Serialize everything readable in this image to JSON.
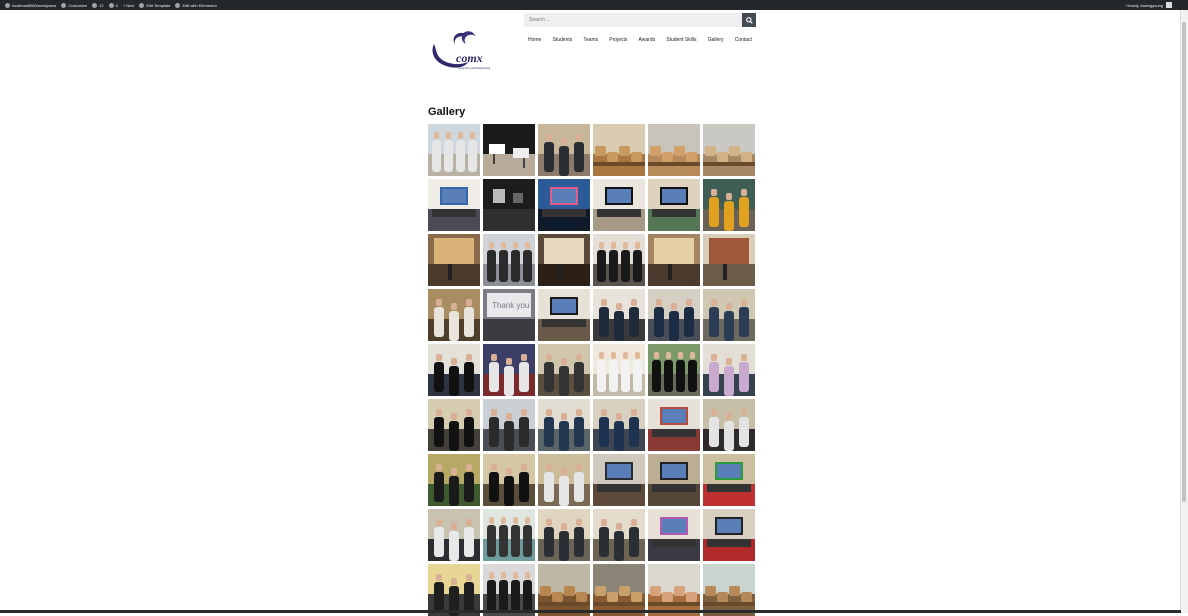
{
  "admin_bar": {
    "site": "localhost8080/wordpress",
    "customize": "Customize",
    "comments": "12",
    "updates": "0",
    "new": "New",
    "edit_template": "Edit Template",
    "elementor": "Edit with Elementor",
    "howdy": "Howdy, kwangyoung"
  },
  "header": {
    "search_placeholder": "Search ...",
    "logo_text": "comx",
    "logo_tagline": "Computing and Engineering"
  },
  "nav": [
    "Home",
    "Students",
    "Teams",
    "Projects",
    "Awards",
    "Student Skills",
    "Gallery",
    "Contact"
  ],
  "page": {
    "title": "Gallery"
  },
  "gallery": {
    "photos": [
      {
        "scene": "people-group",
        "sky": "#cfd6dc",
        "floor": "#b9b0a6",
        "fig": "#e6e6e6"
      },
      {
        "scene": "tables",
        "sky": "#1b1b1b",
        "floor": "#b7aa98",
        "fig": "#ddd"
      },
      {
        "scene": "people",
        "sky": "#c9b79b",
        "floor": "#8c7b6a",
        "fig": "#2a2e35"
      },
      {
        "scene": "food",
        "sky": "#d9cbb1",
        "floor": "#a9773f",
        "fig": "#c69a5e"
      },
      {
        "scene": "food",
        "sky": "#c8c3bb",
        "floor": "#b78a5a",
        "fig": "#d4a06a"
      },
      {
        "scene": "food",
        "sky": "#c9c8c2",
        "floor": "#a78865",
        "fig": "#d2b287"
      },
      {
        "scene": "screen",
        "sky": "#f0ede6",
        "floor": "#4b4b55",
        "fig": "#3366aa"
      },
      {
        "scene": "dark",
        "sky": "#1c1c1c",
        "floor": "#2f2f2f",
        "fig": "#bbb"
      },
      {
        "scene": "screen",
        "sky": "#2a5a98",
        "floor": "#0f1a2b",
        "fig": "#e05a8a"
      },
      {
        "scene": "screen",
        "sky": "#ece7de",
        "floor": "#a69a86",
        "fig": "#111"
      },
      {
        "scene": "screen",
        "sky": "#ddd3bf",
        "floor": "#557755",
        "fig": "#111"
      },
      {
        "scene": "people",
        "sky": "#3e5d55",
        "floor": "#6a6254",
        "fig": "#e0a020"
      },
      {
        "scene": "projector",
        "sky": "#8a6a4a",
        "floor": "#4a3a2a",
        "fig": "#d9b27a"
      },
      {
        "scene": "people-group",
        "sky": "#cfd3d8",
        "floor": "#8a8f96",
        "fig": "#2b2b2b"
      },
      {
        "scene": "projector",
        "sky": "#5a4a3a",
        "floor": "#2a2018",
        "fig": "#e8d9c0"
      },
      {
        "scene": "people-group",
        "sky": "#e3ded6",
        "floor": "#5a544c",
        "fig": "#1a1a1a"
      },
      {
        "scene": "projector",
        "sky": "#a58461",
        "floor": "#4a3b2e",
        "fig": "#e6cfa5"
      },
      {
        "scene": "projector",
        "sky": "#d8cdb9",
        "floor": "#6b5b49",
        "fig": "#a05a3a"
      },
      {
        "scene": "people",
        "sky": "#a98d62",
        "floor": "#4e3f2c",
        "fig": "#e8e4dc"
      },
      {
        "scene": "thankyou",
        "sky": "#7a7d86",
        "floor": "#3a3c42",
        "fig": "#e8e8ea"
      },
      {
        "scene": "screen",
        "sky": "#e6e2d8",
        "floor": "#6a5a4a",
        "fig": "#1a1a1a"
      },
      {
        "scene": "people",
        "sky": "#e7e3da",
        "floor": "#3a3a3a",
        "fig": "#1f2a3a"
      },
      {
        "scene": "people",
        "sky": "#d5cfc4",
        "floor": "#4a4e58",
        "fig": "#1c2c44"
      },
      {
        "scene": "people",
        "sky": "#cfc7b2",
        "floor": "#6d6a5d",
        "fig": "#2b3c55"
      },
      {
        "scene": "people",
        "sky": "#e4e1d9",
        "floor": "#2e3442",
        "fig": "#111"
      },
      {
        "scene": "people",
        "sky": "#3b3f66",
        "floor": "#7a2a2a",
        "fig": "#e6e6e6"
      },
      {
        "scene": "people",
        "sky": "#cfc6ad",
        "floor": "#5a5040",
        "fig": "#333"
      },
      {
        "scene": "people-group",
        "sky": "#efe9dd",
        "floor": "#c2b9a9",
        "fig": "#f2f2f2"
      },
      {
        "scene": "people-group",
        "sky": "#7d9a6a",
        "floor": "#6a6a5a",
        "fig": "#111"
      },
      {
        "scene": "people",
        "sky": "#e4dfd6",
        "floor": "#34414f",
        "fig": "#c9a9ce"
      },
      {
        "scene": "people",
        "sky": "#d6ccb0",
        "floor": "#44403a",
        "fig": "#111"
      },
      {
        "scene": "people",
        "sky": "#c9cfd2",
        "floor": "#4a4e55",
        "fig": "#2b2b2b"
      },
      {
        "scene": "people",
        "sky": "#e2ddd3",
        "floor": "#5a6466",
        "fig": "#22364f"
      },
      {
        "scene": "people",
        "sky": "#d8d1c1",
        "floor": "#3e4652",
        "fig": "#1e3252"
      },
      {
        "scene": "screen",
        "sky": "#e5e1d8",
        "floor": "#8a3a34",
        "fig": "#b44c3c"
      },
      {
        "scene": "people",
        "sky": "#c7bea8",
        "floor": "#2e2b2a",
        "fig": "#e3e3e3"
      },
      {
        "scene": "people",
        "sky": "#b8a866",
        "floor": "#3f5a2f",
        "fig": "#1a1a1a"
      },
      {
        "scene": "people",
        "sky": "#d5c6a4",
        "floor": "#5a4e3a",
        "fig": "#111"
      },
      {
        "scene": "people",
        "sky": "#ccbc9a",
        "floor": "#7a6a55",
        "fig": "#e6e6e6"
      },
      {
        "scene": "screen",
        "sky": "#cfc9bd",
        "floor": "#5d4a3a",
        "fig": "#2b2b33"
      },
      {
        "scene": "screen",
        "sky": "#bcae95",
        "floor": "#55463a",
        "fig": "#222"
      },
      {
        "scene": "screen",
        "sky": "#cdbf9f",
        "floor": "#c03030",
        "fig": "#2a9a3a"
      },
      {
        "scene": "people",
        "sky": "#c8c2b0",
        "floor": "#2e2e32",
        "fig": "#e8e8e8"
      },
      {
        "scene": "people-group",
        "sky": "#dfe6e0",
        "floor": "#6d9a9a",
        "fig": "#333"
      },
      {
        "scene": "people",
        "sky": "#e0d6c0",
        "floor": "#6a6457",
        "fig": "#2a2e35"
      },
      {
        "scene": "people",
        "sky": "#e4dccd",
        "floor": "#6e6454",
        "fig": "#2a2e35"
      },
      {
        "scene": "screen",
        "sky": "#e6e0d6",
        "floor": "#3a3a44",
        "fig": "#b35ab0"
      },
      {
        "scene": "screen",
        "sky": "#d8cfc0",
        "floor": "#b02a2a",
        "fig": "#222"
      },
      {
        "scene": "people",
        "sky": "#e7d694",
        "floor": "#3a3a3a",
        "fig": "#1f1f1f"
      },
      {
        "scene": "people-group",
        "sky": "#d9d9d9",
        "floor": "#4a4a4a",
        "fig": "#1a1a1a"
      },
      {
        "scene": "food",
        "sky": "#bfb7a6",
        "floor": "#7a5530",
        "fig": "#b8874f"
      },
      {
        "scene": "food",
        "sky": "#8c8476",
        "floor": "#8a5a33",
        "fig": "#caa06a"
      },
      {
        "scene": "food",
        "sky": "#dad7cf",
        "floor": "#a86d3e",
        "fig": "#d6a27a"
      },
      {
        "scene": "food",
        "sky": "#c9d4cf",
        "floor": "#7b6140",
        "fig": "#b58a58"
      }
    ]
  }
}
